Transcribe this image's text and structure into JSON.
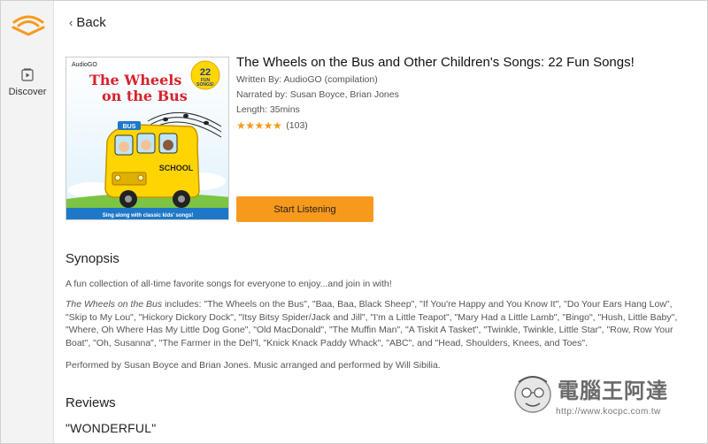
{
  "sidebar": {
    "logo_icon": "audible-logo-icon",
    "items": [
      {
        "label": "Discover",
        "icon": "discover-icon"
      }
    ]
  },
  "nav": {
    "back_label": "Back"
  },
  "book": {
    "cover_publisher": "AudioGO",
    "cover_title_line1": "The Wheels",
    "cover_title_line2": "on the Bus",
    "cover_badge_number": "22",
    "cover_badge_text1": "FUN",
    "cover_badge_text2": "SONGS!",
    "cover_bus_label": "BUS",
    "cover_school_label": "SCHOOL",
    "cover_tagline": "Sing along with classic kids' songs!",
    "title": "The Wheels on the Bus and Other Children's Songs: 22 Fun Songs!",
    "written_by": "Written By: AudioGO (compilation)",
    "narrated_by": "Narrated by: Susan Boyce, Brian Jones",
    "length": "Length: 35mins",
    "rating_stars": 5,
    "rating_count": "(103)",
    "listen_label": "Start Listening"
  },
  "synopsis": {
    "heading": "Synopsis",
    "p1": "A fun collection of all-time favorite songs for everyone to enjoy...and join in with!",
    "p2_italic": "The Wheels on the Bus",
    "p2_rest": " includes: \"The Wheels on the Bus\", \"Baa, Baa, Black Sheep\", \"If You're Happy and You Know It\", \"Do Your Ears Hang Low\", \"Skip to My Lou\", \"Hickory Dickory Dock\", \"Itsy Bitsy Spider/Jack and Jill\", \"I'm a Little Teapot\", \"Mary Had a Little Lamb\", \"Bingo\", \"Hush, Little Baby\", \"Where, Oh Where Has My Little Dog Gone\", \"Old MacDonald\", \"The Muffin Man\", \"A Tiskit A Tasket\", \"Twinkle, Twinkle, Little Star\", \"Row, Row Your Boat\", \"Oh, Susanna\", \"The Farmer in the Del\"l, \"Knick Knack Paddy Whack\", \"ABC\", and \"Head, Shoulders, Knees, and Toes\".",
    "p3": "Performed by Susan Boyce and Brian Jones. Music arranged and performed by Will Sibilia."
  },
  "reviews": {
    "heading": "Reviews",
    "first_title": "\"WONDERFUL\""
  },
  "watermark": {
    "text": "電腦王阿達",
    "url": "http://www.kocpc.com.tw"
  },
  "colors": {
    "accent": "#f7991c",
    "sidebar_bg": "#f3f3f3",
    "text_dark": "#222222",
    "text_muted": "#555555"
  }
}
